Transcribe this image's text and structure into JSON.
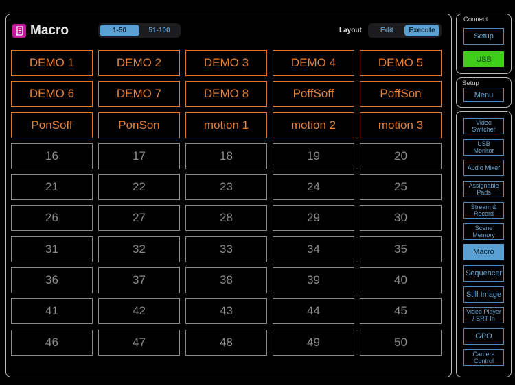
{
  "header": {
    "title": "Macro",
    "icon": "macro-scroll-icon",
    "page_tabs": [
      "1-50",
      "51-100"
    ],
    "active_page_tab": 0,
    "layout_label": "Layout",
    "layout_tabs": [
      "Edit",
      "Execute"
    ],
    "active_layout_tab": 1
  },
  "macros": [
    {
      "label": "DEMO 1",
      "used": true
    },
    {
      "label": "DEMO 2",
      "used": true
    },
    {
      "label": "DEMO 3",
      "used": true
    },
    {
      "label": "DEMO 4",
      "used": true
    },
    {
      "label": "DEMO 5",
      "used": true
    },
    {
      "label": "DEMO 6",
      "used": true
    },
    {
      "label": "DEMO 7",
      "used": true
    },
    {
      "label": "DEMO 8",
      "used": true
    },
    {
      "label": "PoffSoff",
      "used": true
    },
    {
      "label": "PoffSon",
      "used": true
    },
    {
      "label": "PonSoff",
      "used": true
    },
    {
      "label": "PonSon",
      "used": true
    },
    {
      "label": "motion 1",
      "used": true
    },
    {
      "label": "motion 2",
      "used": true
    },
    {
      "label": "motion 3",
      "used": true
    },
    {
      "label": "16"
    },
    {
      "label": "17"
    },
    {
      "label": "18"
    },
    {
      "label": "19"
    },
    {
      "label": "20"
    },
    {
      "label": "21"
    },
    {
      "label": "22"
    },
    {
      "label": "23"
    },
    {
      "label": "24"
    },
    {
      "label": "25"
    },
    {
      "label": "26"
    },
    {
      "label": "27"
    },
    {
      "label": "28"
    },
    {
      "label": "29"
    },
    {
      "label": "30"
    },
    {
      "label": "31"
    },
    {
      "label": "32"
    },
    {
      "label": "33"
    },
    {
      "label": "34"
    },
    {
      "label": "35"
    },
    {
      "label": "36"
    },
    {
      "label": "37"
    },
    {
      "label": "38"
    },
    {
      "label": "39"
    },
    {
      "label": "40"
    },
    {
      "label": "41"
    },
    {
      "label": "42"
    },
    {
      "label": "43"
    },
    {
      "label": "44"
    },
    {
      "label": "45"
    },
    {
      "label": "46"
    },
    {
      "label": "47"
    },
    {
      "label": "48"
    },
    {
      "label": "49"
    },
    {
      "label": "50"
    }
  ],
  "connect": {
    "label": "Connect",
    "setup": "Setup",
    "usb": "USB"
  },
  "setup": {
    "label": "Setup",
    "menu": "Menu"
  },
  "nav": [
    {
      "l1": "Video",
      "l2": "Switcher"
    },
    {
      "l1": "USB",
      "l2": "Monitor"
    },
    {
      "l1": "Audio Mixer"
    },
    {
      "l1": "Assignable",
      "l2": "Pads"
    },
    {
      "l1": "Stream &",
      "l2": "Record"
    },
    {
      "l1": "Scene",
      "l2": "Memory"
    },
    {
      "l1": "Macro",
      "active": true,
      "big": true
    },
    {
      "l1": "Sequencer",
      "big": true
    },
    {
      "l1": "Still Image",
      "big": true
    },
    {
      "l1": "Video Player",
      "l2": "/ SRT In"
    },
    {
      "l1": "GPO",
      "big": true
    },
    {
      "l1": "Camera",
      "l2": "Control"
    }
  ],
  "colors": {
    "used": "#e3823a",
    "accent": "#5aa0d2",
    "usb": "#3fcf19"
  }
}
